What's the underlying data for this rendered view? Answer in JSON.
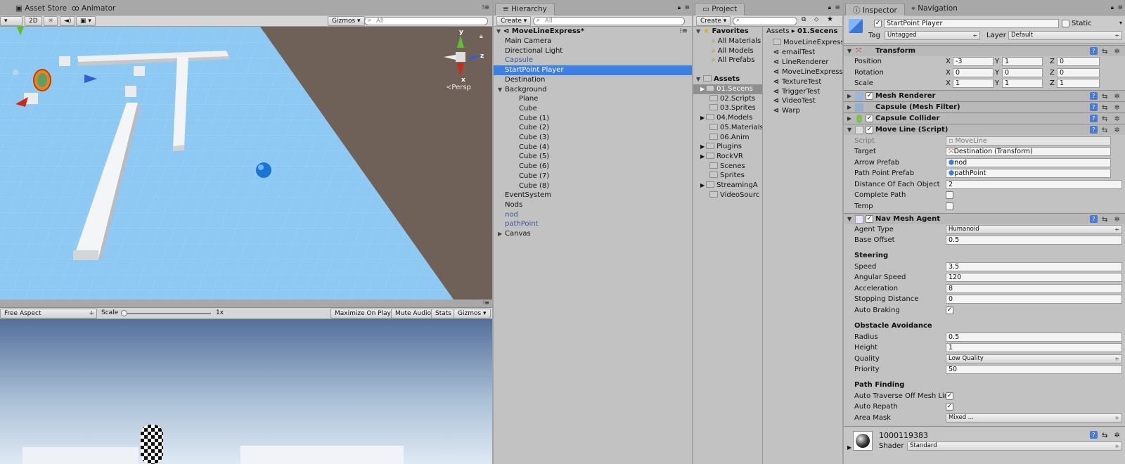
{
  "scene_panel": {
    "tabs": [
      "Asset Store",
      "Animator"
    ],
    "toolbar": {
      "mode": "2D",
      "gizmos": "Gizmos",
      "search_placeholder": "All"
    },
    "persp_label": "Persp",
    "axis_labels": {
      "x": "x",
      "y": "y",
      "z": "z"
    }
  },
  "game_panel": {
    "aspect": "Free Aspect",
    "scale_label": "Scale",
    "scale_value": "1x",
    "buttons": [
      "Maximize On Play",
      "Mute Audio",
      "Stats",
      "Gizmos"
    ]
  },
  "hierarchy": {
    "tab": "Hierarchy",
    "create": "Create",
    "search_placeholder": "All",
    "scene_name": "MoveLineExpress*",
    "items": [
      {
        "label": "Main Camera",
        "indent": 1
      },
      {
        "label": "Directional Light",
        "indent": 1
      },
      {
        "label": "Capsule",
        "indent": 1,
        "prefab": true
      },
      {
        "label": "StartPoint Player",
        "indent": 1,
        "selected": true
      },
      {
        "label": "Destination",
        "indent": 1
      },
      {
        "label": "Background",
        "indent": 1,
        "expanded": true
      },
      {
        "label": "Plane",
        "indent": 2
      },
      {
        "label": "Cube",
        "indent": 2
      },
      {
        "label": "Cube (1)",
        "indent": 2
      },
      {
        "label": "Cube (2)",
        "indent": 2
      },
      {
        "label": "Cube (3)",
        "indent": 2
      },
      {
        "label": "Cube (4)",
        "indent": 2
      },
      {
        "label": "Cube (5)",
        "indent": 2
      },
      {
        "label": "Cube (6)",
        "indent": 2
      },
      {
        "label": "Cube (7)",
        "indent": 2
      },
      {
        "label": "Cube (8)",
        "indent": 2
      },
      {
        "label": "EventSystem",
        "indent": 1
      },
      {
        "label": "Nods",
        "indent": 1
      },
      {
        "label": "nod",
        "indent": 1,
        "prefab": true
      },
      {
        "label": "pathPoint",
        "indent": 1,
        "prefab": true
      },
      {
        "label": "Canvas",
        "indent": 1,
        "collapsed": true
      }
    ]
  },
  "project": {
    "tab": "Project",
    "create": "Create",
    "favorites_label": "Favorites",
    "favorites": [
      "All Materials",
      "All Models",
      "All Prefabs"
    ],
    "assets_label": "Assets",
    "folders": [
      {
        "label": "01.Secens",
        "selected": true,
        "arrow": true
      },
      {
        "label": "02.Scripts"
      },
      {
        "label": "03.Sprites"
      },
      {
        "label": "04.Models",
        "arrow": true
      },
      {
        "label": "05.Materials"
      },
      {
        "label": "06.Anim"
      },
      {
        "label": "Plugins",
        "arrow": true
      },
      {
        "label": "RockVR",
        "arrow": true
      },
      {
        "label": "Scenes"
      },
      {
        "label": "Sprites"
      },
      {
        "label": "StreamingA",
        "arrow": true
      },
      {
        "label": "VideoSourc"
      }
    ],
    "breadcrumb_root": "Assets",
    "breadcrumb_sep": "▸",
    "breadcrumb_current": "01.Secens",
    "files": [
      {
        "label": "MoveLineExpress",
        "icon": "folder"
      },
      {
        "label": "emailTest",
        "icon": "scene"
      },
      {
        "label": "LineRenderer",
        "icon": "scene"
      },
      {
        "label": "MoveLineExpress",
        "icon": "scene"
      },
      {
        "label": "TextureTest",
        "icon": "scene"
      },
      {
        "label": "TriggerTest",
        "icon": "scene"
      },
      {
        "label": "VideoTest",
        "icon": "scene"
      },
      {
        "label": "Warp",
        "icon": "scene"
      }
    ]
  },
  "inspector": {
    "tabs": [
      "Inspector",
      "Navigation"
    ],
    "object_name": "StartPoint Player",
    "static_label": "Static",
    "tag_label": "Tag",
    "tag_value": "Untagged",
    "layer_label": "Layer",
    "layer_value": "Default",
    "transform": {
      "title": "Transform",
      "position": {
        "label": "Position",
        "x": "-3",
        "y": "1",
        "z": "0"
      },
      "rotation": {
        "label": "Rotation",
        "x": "0",
        "y": "0",
        "z": "0"
      },
      "scale": {
        "label": "Scale",
        "x": "1",
        "y": "1",
        "z": "1"
      }
    },
    "mesh_renderer": "Mesh Renderer",
    "mesh_filter": "Capsule (Mesh Filter)",
    "capsule_collider": "Capsule Collider",
    "move_line": {
      "title": "Move Line (Script)",
      "script_label": "Script",
      "script_value": "MoveLine",
      "target_label": "Target",
      "target_value": "Destination (Transform)",
      "arrow_label": "Arrow Prefab",
      "arrow_value": "nod",
      "path_label": "Path Point Prefab",
      "path_value": "pathPoint",
      "distance_label": "Distance Of Each Object",
      "distance_value": "2",
      "complete_label": "Complete Path",
      "temp_label": "Temp"
    },
    "nav_mesh_agent": {
      "title": "Nav Mesh Agent",
      "agent_type_label": "Agent Type",
      "agent_type_value": "Humanoid",
      "base_offset_label": "Base Offset",
      "base_offset_value": "0.5",
      "steering_header": "Steering",
      "speed_label": "Speed",
      "speed_value": "3.5",
      "angular_label": "Angular Speed",
      "angular_value": "120",
      "accel_label": "Acceleration",
      "accel_value": "8",
      "stopping_label": "Stopping Distance",
      "stopping_value": "0",
      "braking_label": "Auto Braking",
      "obstacle_header": "Obstacle Avoidance",
      "radius_label": "Radius",
      "radius_value": "0.5",
      "height_label": "Height",
      "height_value": "1",
      "quality_label": "Quality",
      "quality_value": "Low Quality",
      "priority_label": "Priority",
      "priority_value": "50",
      "pathfinding_header": "Path Finding",
      "traverse_label": "Auto Traverse Off Mesh Lin",
      "repath_label": "Auto Repath",
      "area_label": "Area Mask",
      "area_value": "Mixed ..."
    },
    "material": {
      "name": "1000119383",
      "shader_label": "Shader",
      "shader_value": "Standard"
    }
  },
  "colors": {
    "selection": "#3d80e4",
    "sky_grid": "#8ec9f3",
    "void": "#6f6158"
  }
}
